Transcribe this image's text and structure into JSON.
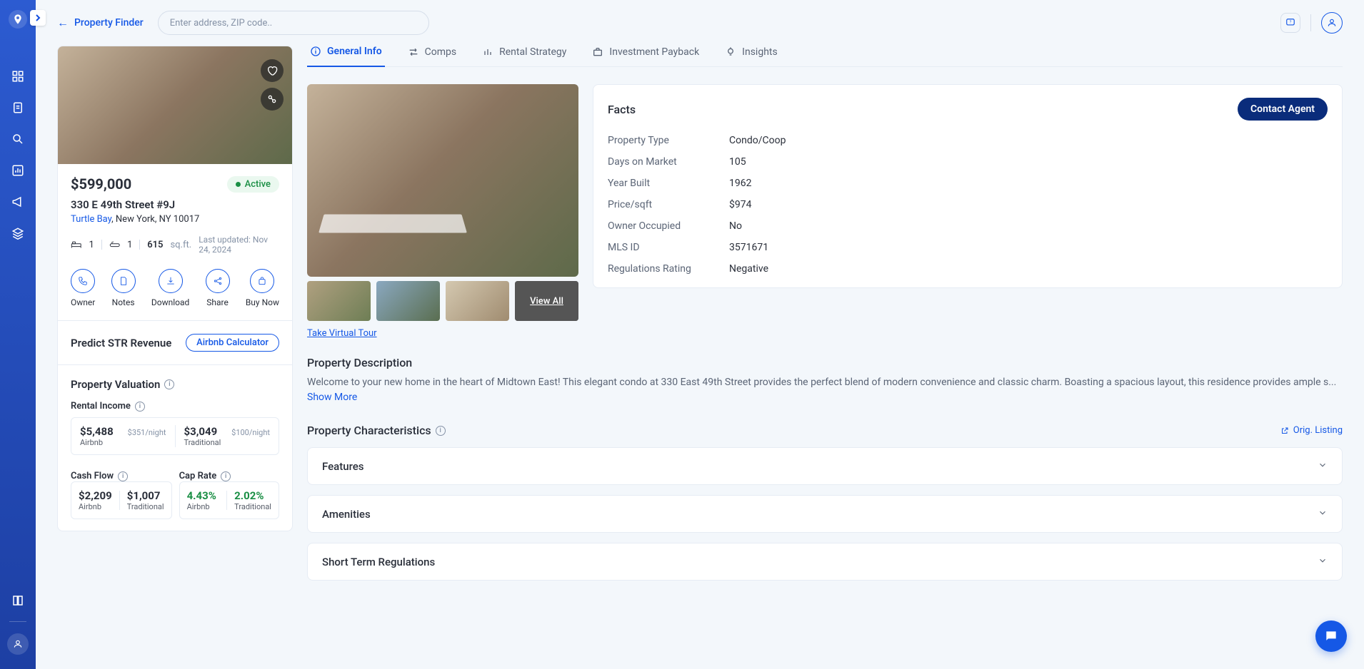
{
  "back_label": "Property Finder",
  "search_placeholder": "Enter address, ZIP code..",
  "property": {
    "price": "$599,000",
    "status": "Active",
    "address": "330 E 49th Street #9J",
    "area": "Turtle Bay",
    "locality": ", New York, NY 10017",
    "beds": "1",
    "baths": "1",
    "sqft": "615",
    "sqft_unit": "sq.ft.",
    "last_updated": "Last updated: Nov 24, 2024"
  },
  "actions": {
    "owner": "Owner",
    "notes": "Notes",
    "download": "Download",
    "share": "Share",
    "buy_now": "Buy Now"
  },
  "predict": {
    "title": "Predict STR Revenue",
    "calc": "Airbnb Calculator"
  },
  "valuation": {
    "title": "Property Valuation",
    "rental_income": "Rental Income",
    "airbnb_val": "$5,488",
    "airbnb_night": "$351/night",
    "trad_val": "$3,049",
    "trad_night": "$100/night",
    "airbnb_label": "Airbnb",
    "trad_label": "Traditional",
    "cash_flow": "Cash Flow",
    "cap_rate": "Cap Rate",
    "cf_airbnb": "$2,209",
    "cf_trad": "$1,007",
    "cap_airbnb": "4.43%",
    "cap_trad": "2.02%"
  },
  "tabs": {
    "general": "General Info",
    "comps": "Comps",
    "rental": "Rental Strategy",
    "invest": "Investment Payback",
    "insights": "Insights"
  },
  "facts": {
    "title": "Facts",
    "contact": "Contact Agent",
    "rows": {
      "property_type_k": "Property Type",
      "property_type_v": "Condo/Coop",
      "days_k": "Days on Market",
      "days_v": "105",
      "year_k": "Year Built",
      "year_v": "1962",
      "psqft_k": "Price/sqft",
      "psqft_v": "$974",
      "owner_k": "Owner Occupied",
      "owner_v": "No",
      "mls_k": "MLS ID",
      "mls_v": "3571671",
      "reg_k": "Regulations Rating",
      "reg_v": "Negative"
    }
  },
  "gallery": {
    "view_all": "View All",
    "virtual": "Take Virtual Tour"
  },
  "description": {
    "title": "Property Description",
    "body": "Welcome to your new home in the heart of Midtown East! This elegant condo at 330 East 49th Street provides the perfect blend of modern convenience and classic charm. Boasting a spacious layout, this residence provides ample s... ",
    "show_more": "Show More"
  },
  "characteristics": {
    "title": "Property Characteristics",
    "orig": "Orig. Listing",
    "features": "Features",
    "amenities": "Amenities",
    "str": "Short Term Regulations"
  }
}
